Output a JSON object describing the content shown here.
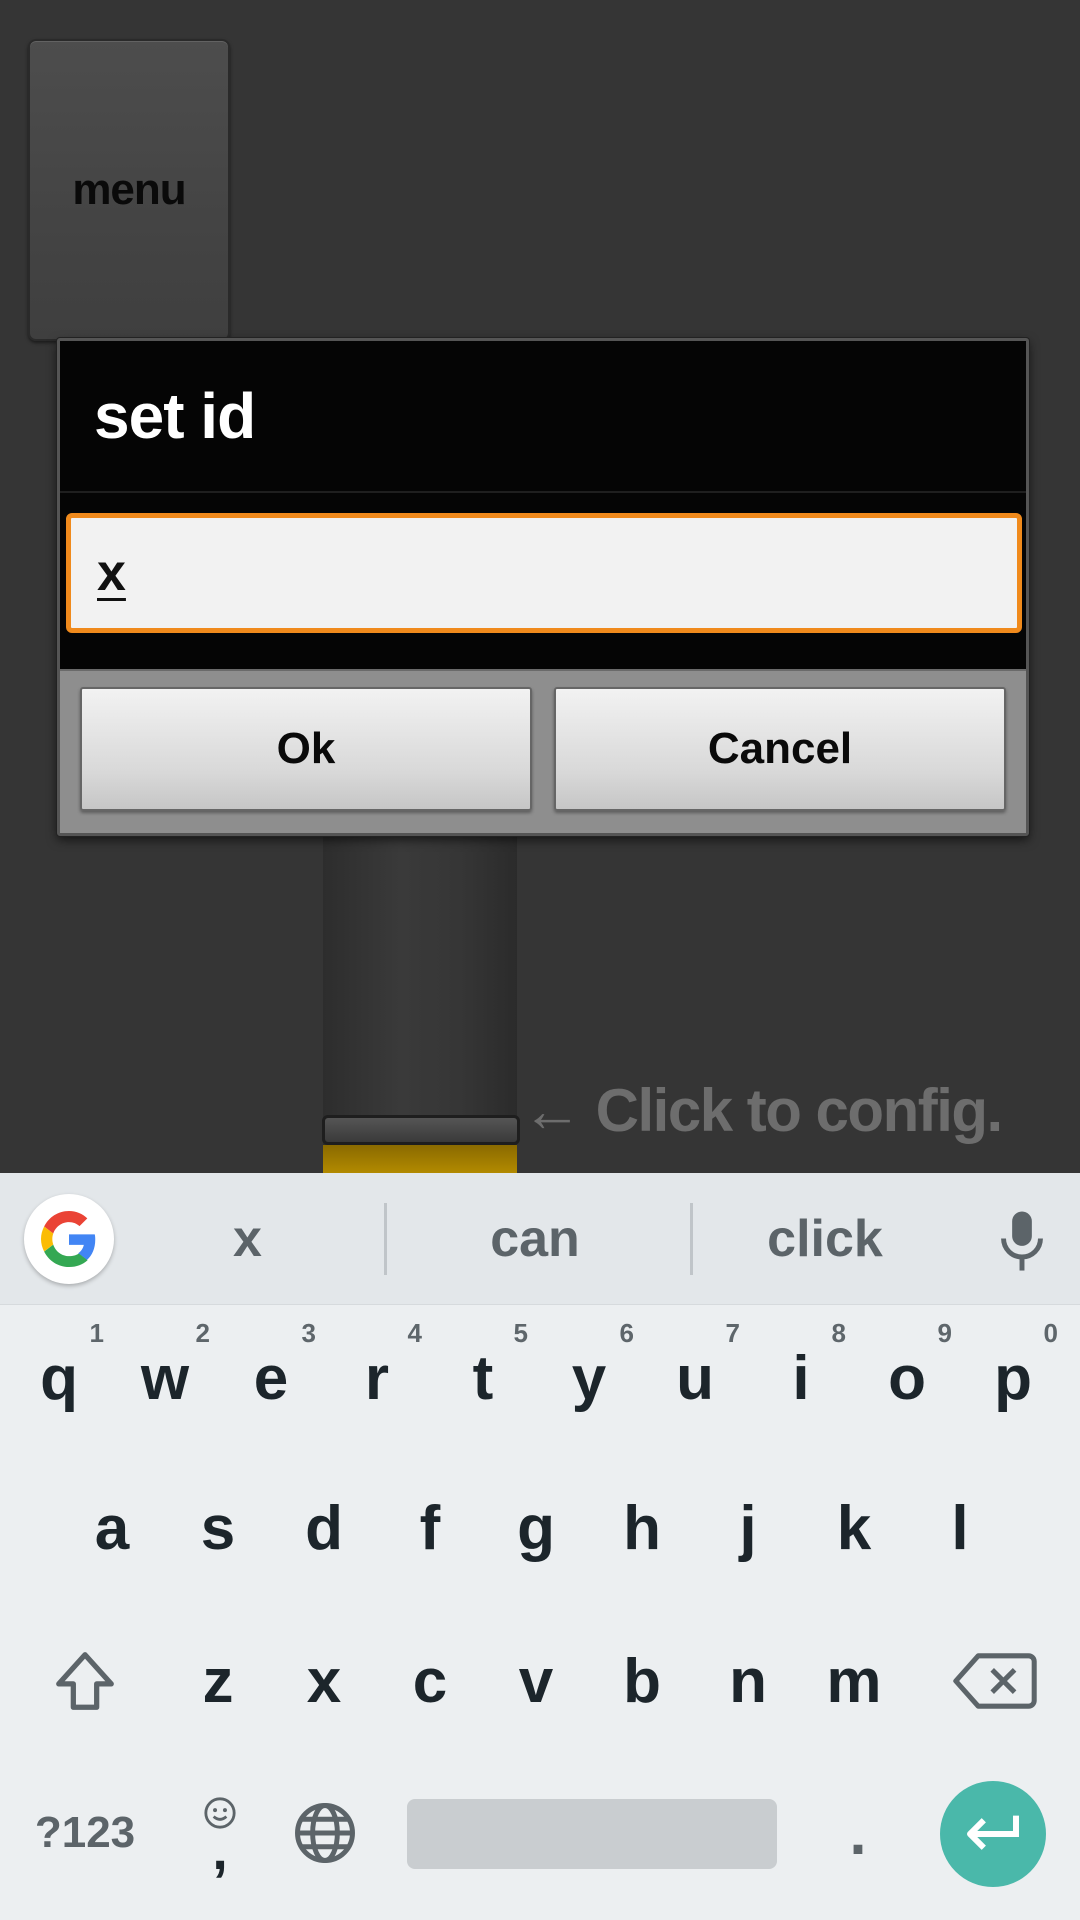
{
  "app": {
    "menu_label": "menu",
    "config_hint": "← Click to config."
  },
  "dialog": {
    "title": "set id",
    "input_value": "x",
    "ok_label": "Ok",
    "cancel_label": "Cancel",
    "input_border_color": "#f08a1c"
  },
  "keyboard": {
    "suggestions": [
      "x",
      "can",
      "click"
    ],
    "row1": [
      {
        "key": "q",
        "hint": "1"
      },
      {
        "key": "w",
        "hint": "2"
      },
      {
        "key": "e",
        "hint": "3"
      },
      {
        "key": "r",
        "hint": "4"
      },
      {
        "key": "t",
        "hint": "5"
      },
      {
        "key": "y",
        "hint": "6"
      },
      {
        "key": "u",
        "hint": "7"
      },
      {
        "key": "i",
        "hint": "8"
      },
      {
        "key": "o",
        "hint": "9"
      },
      {
        "key": "p",
        "hint": "0"
      }
    ],
    "row2": [
      "a",
      "s",
      "d",
      "f",
      "g",
      "h",
      "j",
      "k",
      "l"
    ],
    "row3": [
      "z",
      "x",
      "c",
      "v",
      "b",
      "n",
      "m"
    ],
    "symbols_label": "?123",
    "comma_label": ",",
    "period_label": ".",
    "enter_color": "#4ab8aa",
    "icons": [
      "google-icon",
      "mic-icon",
      "shift-icon",
      "backspace-icon",
      "emoji-icon",
      "globe-icon",
      "enter-icon"
    ]
  }
}
